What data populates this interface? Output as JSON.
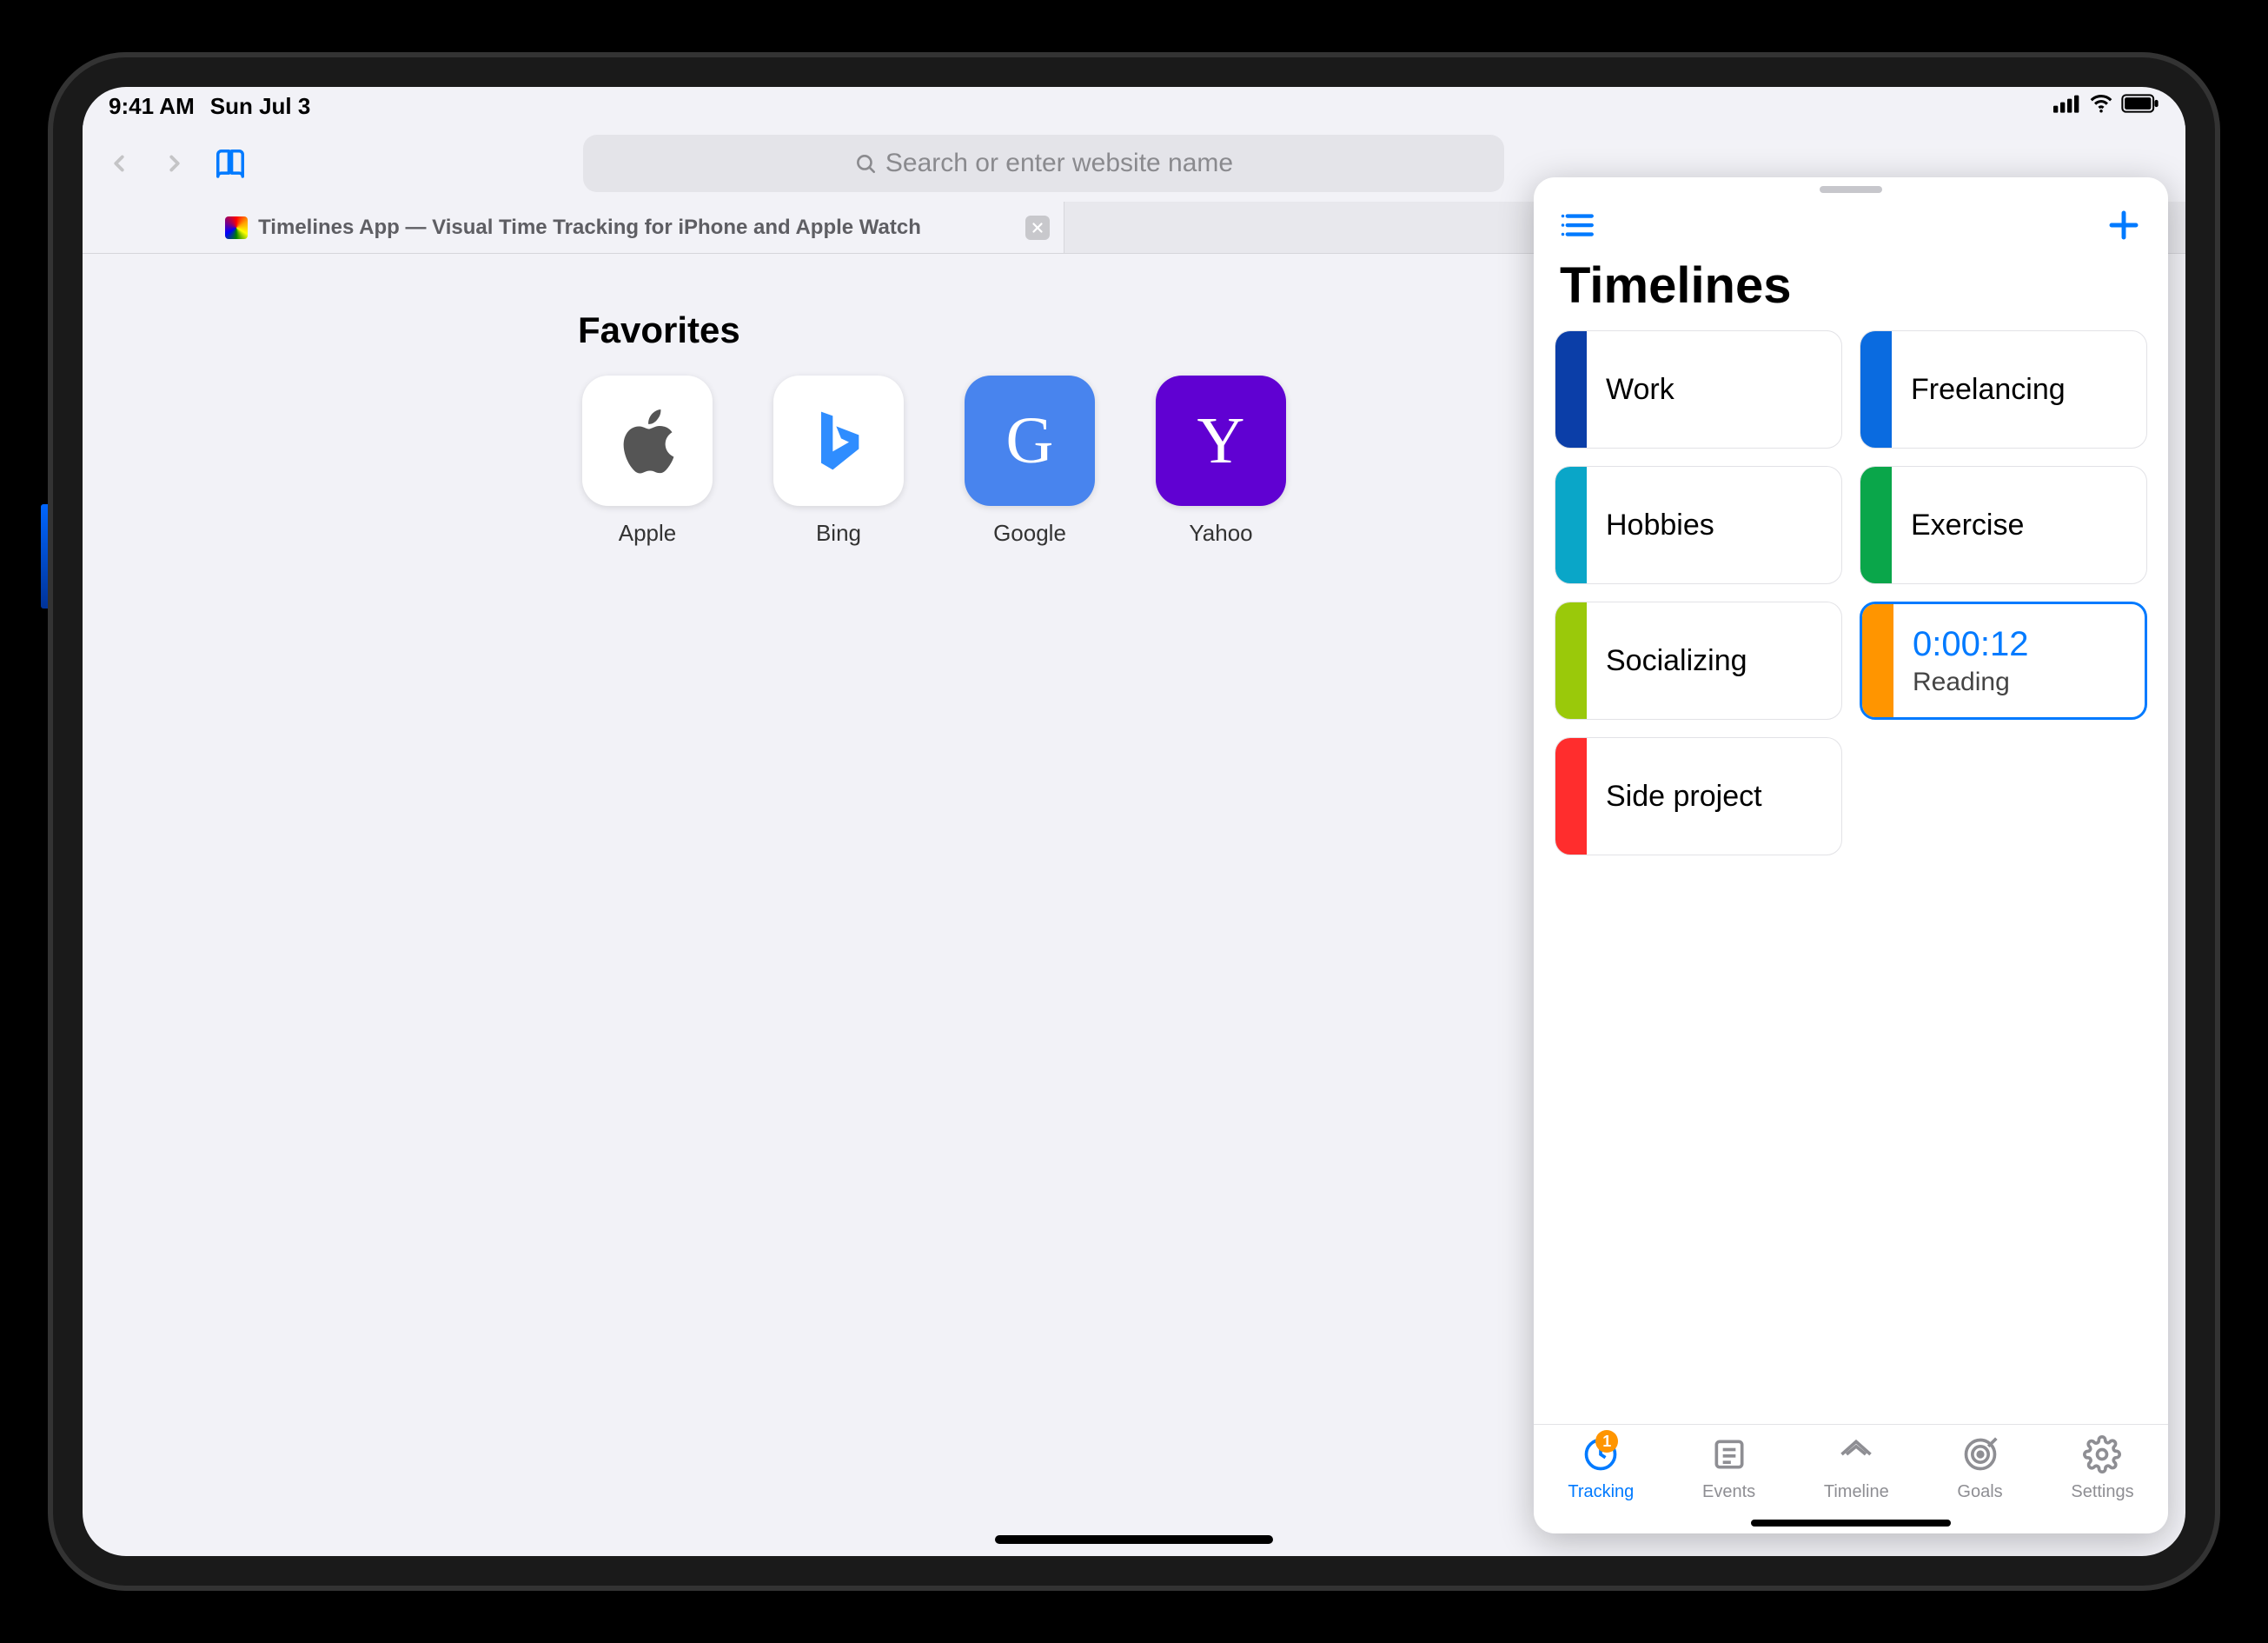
{
  "status": {
    "time": "9:41 AM",
    "date": "Sun Jul 3"
  },
  "safari": {
    "url_placeholder": "Search or enter website name",
    "tab_title": "Timelines App — Visual Time Tracking for iPhone and Apple Watch",
    "favorites_heading": "Favorites",
    "favorites": [
      {
        "label": "Apple",
        "bg": "#ffffff",
        "fg": "#555555",
        "glyph": "apple"
      },
      {
        "label": "Bing",
        "bg": "#ffffff",
        "fg": "#2f8dff",
        "glyph": "bing"
      },
      {
        "label": "Google",
        "bg": "#4884ee",
        "fg": "#ffffff",
        "glyph": "G"
      },
      {
        "label": "Yahoo",
        "bg": "#6001d2",
        "fg": "#ffffff",
        "glyph": "Y"
      }
    ]
  },
  "slideover": {
    "title": "Timelines",
    "tiles": [
      {
        "name": "Work",
        "color": "#0b3ea8"
      },
      {
        "name": "Freelancing",
        "color": "#0a6be0"
      },
      {
        "name": "Hobbies",
        "color": "#0aa6c8"
      },
      {
        "name": "Exercise",
        "color": "#0aa64a"
      },
      {
        "name": "Socializing",
        "color": "#9ac90a"
      },
      {
        "name": "Reading",
        "color": "#ff9500",
        "timer": "0:00:12",
        "active": true
      },
      {
        "name": "Side project",
        "color": "#ff2d2d"
      }
    ],
    "tabs": [
      {
        "label": "Tracking",
        "icon": "clock",
        "active": true,
        "badge": "1"
      },
      {
        "label": "Events",
        "icon": "list",
        "active": false
      },
      {
        "label": "Timeline",
        "icon": "timeline",
        "active": false
      },
      {
        "label": "Goals",
        "icon": "target",
        "active": false
      },
      {
        "label": "Settings",
        "icon": "gear",
        "active": false
      }
    ]
  }
}
